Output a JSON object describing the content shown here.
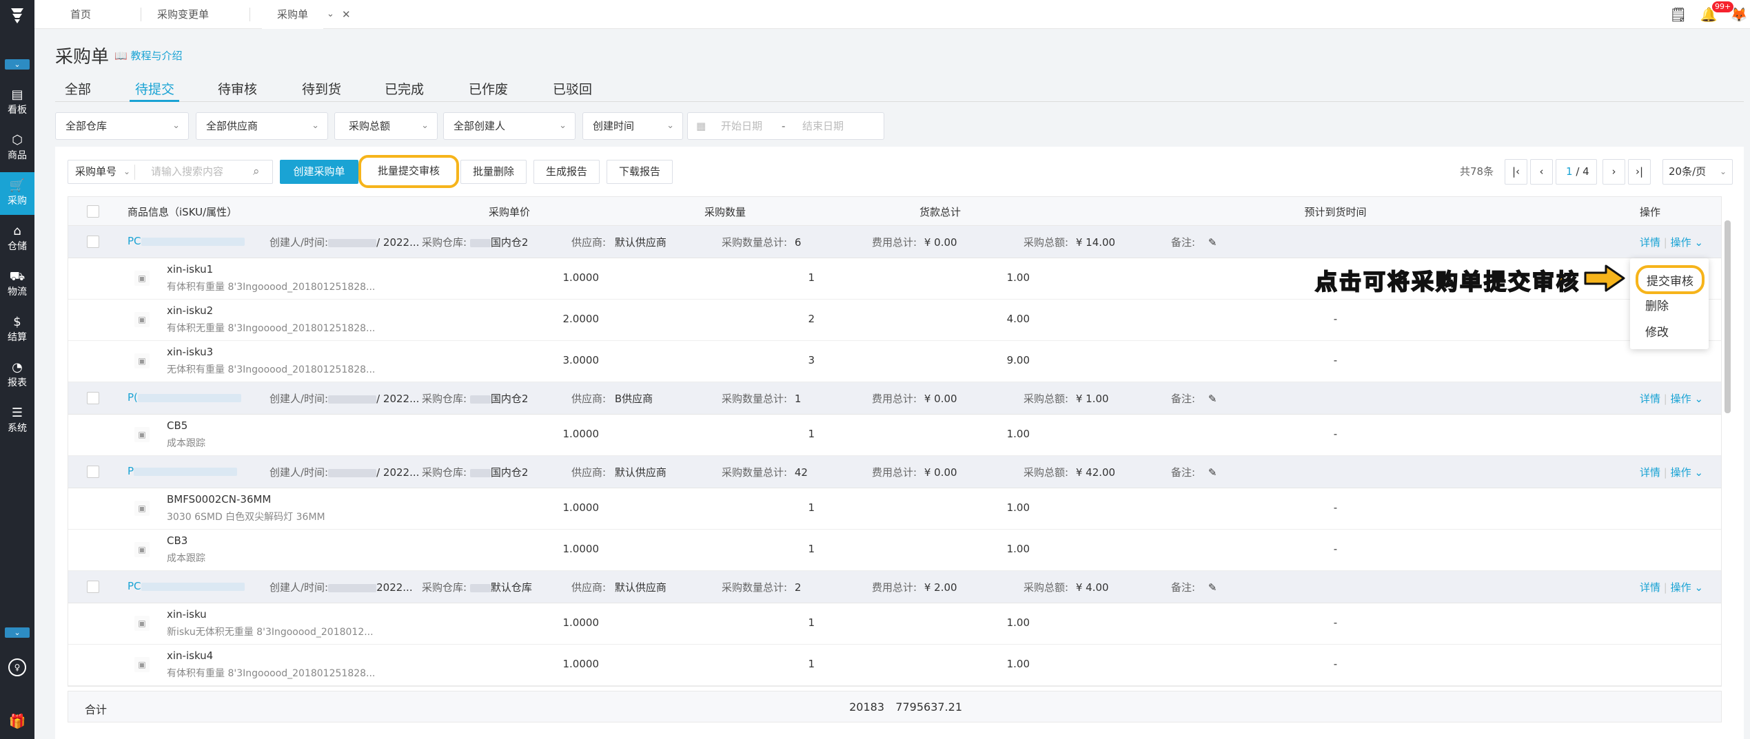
{
  "sidebar": {
    "items": [
      {
        "label": "看板",
        "icon": "dashboard-icon"
      },
      {
        "label": "商品",
        "icon": "box-icon"
      },
      {
        "label": "采购",
        "icon": "cart-icon"
      },
      {
        "label": "仓储",
        "icon": "warehouse-icon"
      },
      {
        "label": "物流",
        "icon": "truck-icon"
      },
      {
        "label": "结算",
        "icon": "money-icon"
      },
      {
        "label": "报表",
        "icon": "chart-icon"
      },
      {
        "label": "系统",
        "icon": "settings-icon"
      }
    ],
    "active": "采购"
  },
  "topbar": {
    "tabs": [
      "首页",
      "采购变更单",
      "采购单"
    ],
    "notif_badge": "99+"
  },
  "page": {
    "title": "采购单",
    "tutorial": "教程与介绍"
  },
  "status_tabs": [
    "全部",
    "待提交",
    "待审核",
    "待到货",
    "已完成",
    "已作废",
    "已驳回"
  ],
  "filters": {
    "warehouse": "全部仓库",
    "supplier": "全部供应商",
    "amount": "采购总额",
    "creator": "全部创建人",
    "time": "创建时间",
    "start_placeholder": "开始日期",
    "sep": "-",
    "end_placeholder": "结束日期"
  },
  "toolbar": {
    "search_type": "采购单号",
    "search_placeholder": "请输入搜索内容",
    "create": "创建采购单",
    "batch_submit": "批量提交审核",
    "batch_delete": "批量删除",
    "gen_report": "生成报告",
    "download": "下载报告"
  },
  "pager": {
    "total": "共78条",
    "current": "1",
    "pages": "/ 4",
    "page_size": "20条/页"
  },
  "columns": {
    "info": "商品信息（iSKU/属性）",
    "price": "采购单价",
    "qty": "采购数量",
    "amount": "货款总计",
    "eta": "预计到货时间",
    "op": "操作"
  },
  "order_labels": {
    "creator": "创建人/时间:",
    "warehouse": "采购仓库:",
    "supplier": "供应商:",
    "qty_total": "采购数量总计:",
    "fee_total": "费用总计:",
    "total": "采购总额:",
    "remark": "备注:",
    "detail": "详情",
    "operate": "操作"
  },
  "orders": [
    {
      "no_prefix": "PC",
      "date": "/ 2022...",
      "warehouse": "国内仓2",
      "supplier": "默认供应商",
      "qty": "6",
      "fee": "¥ 0.00",
      "total": "¥ 14.00",
      "items": [
        {
          "name": "xin-isku1",
          "attr": "有体积有重量 8'3Ingooood_201801251828...",
          "price": "1.0000",
          "qty": "1",
          "amount": "1.00",
          "eta": ""
        },
        {
          "name": "xin-isku2",
          "attr": "有体积无重量 8'3Ingooood_201801251828...",
          "price": "2.0000",
          "qty": "2",
          "amount": "4.00",
          "eta": "-"
        },
        {
          "name": "xin-isku3",
          "attr": "无体积有重量 8'3Ingooood_201801251828...",
          "price": "3.0000",
          "qty": "3",
          "amount": "9.00",
          "eta": "-"
        }
      ]
    },
    {
      "no_prefix": "P(",
      "date": "/ 2022...",
      "warehouse": "国内仓2",
      "supplier": "B供应商",
      "qty": "1",
      "fee": "¥ 0.00",
      "total": "¥ 1.00",
      "items": [
        {
          "name": "CB5",
          "attr": "成本跟踪",
          "price": "1.0000",
          "qty": "1",
          "amount": "1.00",
          "eta": "-"
        }
      ]
    },
    {
      "no_prefix": "P",
      "date": "/ 2022...",
      "warehouse": "国内仓2",
      "supplier": "默认供应商",
      "qty": "42",
      "fee": "¥ 0.00",
      "total": "¥ 42.00",
      "items": [
        {
          "name": "BMFS0002CN-36MM",
          "attr": "3030 6SMD 白色双尖解码灯 36MM",
          "price": "1.0000",
          "qty": "1",
          "amount": "1.00",
          "eta": "-"
        },
        {
          "name": "CB3",
          "attr": "成本跟踪",
          "price": "1.0000",
          "qty": "1",
          "amount": "1.00",
          "eta": "-"
        }
      ]
    },
    {
      "no_prefix": "PC",
      "date": "2022...",
      "warehouse": "默认仓库",
      "supplier": "默认供应商",
      "qty": "2",
      "fee": "¥ 2.00",
      "total": "¥ 4.00",
      "items": [
        {
          "name": "xin-isku",
          "attr": "新isku无体积无重量 8'3Ingooood_2018012...",
          "price": "1.0000",
          "qty": "1",
          "amount": "1.00",
          "eta": "-"
        },
        {
          "name": "xin-isku4",
          "attr": "有体积有重量 8'3Ingooood_201801251828...",
          "price": "1.0000",
          "qty": "1",
          "amount": "1.00",
          "eta": "-"
        }
      ]
    }
  ],
  "summary": {
    "label": "合计",
    "qty": "20183",
    "amount": "7795637.21"
  },
  "dropdown": {
    "items": [
      "提交审核",
      "删除",
      "修改"
    ]
  },
  "annotation": "点击可将采购单提交审核",
  "colors": {
    "accent": "#1aa3d4",
    "highlight": "#f6b41b",
    "sidebar": "#23272f"
  }
}
